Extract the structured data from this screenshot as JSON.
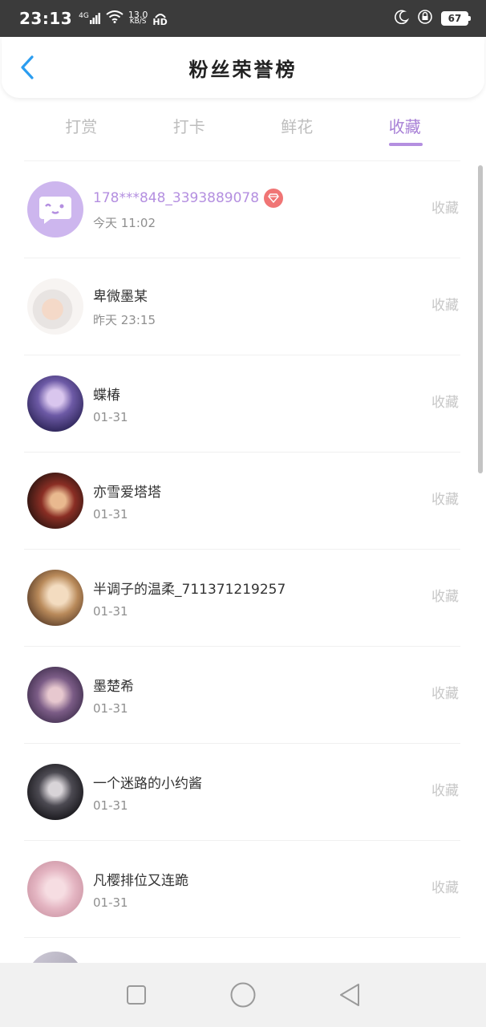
{
  "status_bar": {
    "time": "23:13",
    "network": "4G",
    "speed_value": "13.0",
    "speed_unit": "KB/S",
    "hd": "HD",
    "battery": "67"
  },
  "header": {
    "title": "粉丝荣誉榜",
    "back_icon": "chevron-left-icon"
  },
  "tabs": [
    {
      "label": "打赏",
      "active": false
    },
    {
      "label": "打卡",
      "active": false
    },
    {
      "label": "鲜花",
      "active": false
    },
    {
      "label": "收藏",
      "active": true
    }
  ],
  "list": [
    {
      "name": "178***848_3393889078",
      "time": "今天 11:02",
      "action": "收藏",
      "highlight": true,
      "badge": "gem-icon"
    },
    {
      "name": "卑微墨某",
      "time": "昨天 23:15",
      "action": "收藏"
    },
    {
      "name": "蝶椿",
      "time": "01-31",
      "action": "收藏"
    },
    {
      "name": "亦雪爱塔塔",
      "time": "01-31",
      "action": "收藏"
    },
    {
      "name": "半调子的温柔_711371219257",
      "time": "01-31",
      "action": "收藏"
    },
    {
      "name": "墨楚希",
      "time": "01-31",
      "action": "收藏"
    },
    {
      "name": "一个迷路的小约酱",
      "time": "01-31",
      "action": "收藏"
    },
    {
      "name": "凡樱排位又连跪",
      "time": "01-31",
      "action": "收藏"
    }
  ],
  "colors": {
    "accent": "#b48fe0",
    "back_arrow": "#2b9df0",
    "gem_badge": "#f07575",
    "status_bar": "#3b3b3b",
    "nav_bar": "#f1f1f1"
  },
  "nav_bar": {
    "recent_icon": "square-icon",
    "home_icon": "circle-icon",
    "back_icon": "triangle-back-icon"
  }
}
